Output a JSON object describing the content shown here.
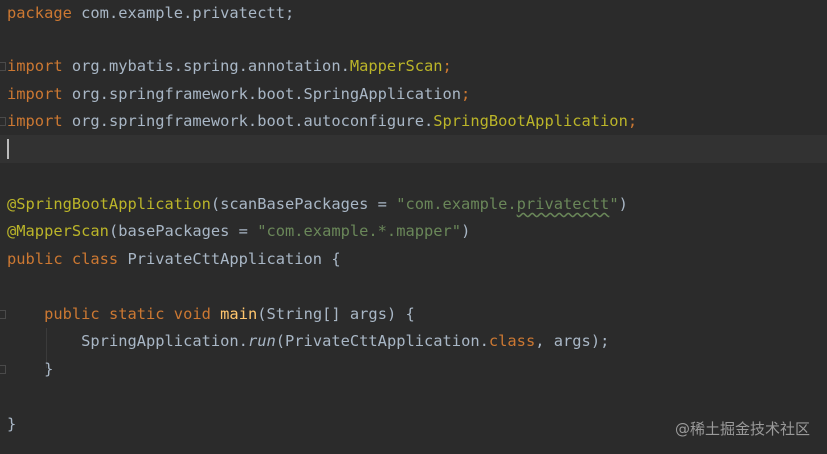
{
  "code": {
    "line1": {
      "kw": "package",
      "rest": " com.example.privatectt;"
    },
    "line3": {
      "kw": "import",
      "pkg": " org.mybatis.spring.annotation.",
      "cls": "MapperScan",
      "end": ";"
    },
    "line4": {
      "kw": "import",
      "pkg": " org.springframework.boot.SpringApplication",
      "end": ";"
    },
    "line5": {
      "kw": "import",
      "pkg": " org.springframework.boot.autoconfigure.",
      "cls": "SpringBootApplication",
      "end": ";"
    },
    "line8": {
      "ann": "@SpringBootApplication",
      "open": "(scanBasePackages = ",
      "str_a": "\"com.example.",
      "str_b": "privatectt",
      "str_c": "\"",
      "close": ")"
    },
    "line9": {
      "ann": "@MapperScan",
      "open": "(basePackages = ",
      "str": "\"com.example.*.mapper\"",
      "close": ")"
    },
    "line10": {
      "kw": "public class",
      "rest": " PrivateCttApplication {"
    },
    "line12": {
      "indent": "    ",
      "kw": "public static void",
      "sp": " ",
      "fn": "main",
      "rest": "(String[] args) {"
    },
    "line13": {
      "indent": "        ",
      "a": "SpringApplication.",
      "run": "run",
      "b": "(PrivateCttApplication.",
      "kw": "class",
      "c": ", args);"
    },
    "line14": {
      "text": "    }"
    },
    "line16": {
      "text": "}"
    }
  },
  "watermark": "@稀土掘金技术社区",
  "colors": {
    "background": "#2b2b2b",
    "keyword": "#cc7832",
    "annotation": "#bbb529",
    "string": "#6a8759",
    "function": "#ffc66d",
    "default": "#a9b7c6"
  }
}
